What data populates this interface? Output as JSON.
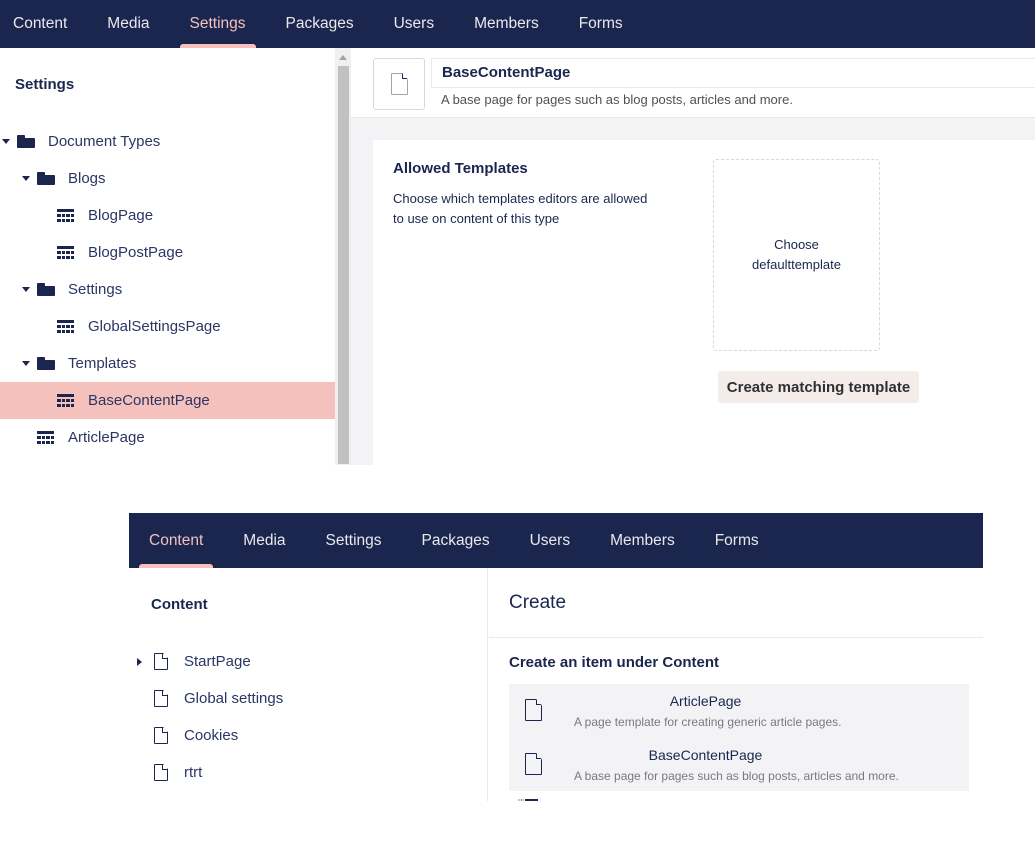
{
  "top": {
    "nav": {
      "items": [
        "Content",
        "Media",
        "Settings",
        "Packages",
        "Users",
        "Members",
        "Forms"
      ],
      "active": "Settings"
    },
    "sidebar": {
      "title": "Settings",
      "tree": [
        {
          "label": "Document Types",
          "type": "folder",
          "expanded": true,
          "level": 0
        },
        {
          "label": "Blogs",
          "type": "folder",
          "expanded": true,
          "level": 1
        },
        {
          "label": "BlogPage",
          "type": "document-type",
          "level": 2
        },
        {
          "label": "BlogPostPage",
          "type": "document-type",
          "level": 2
        },
        {
          "label": "Settings",
          "type": "folder",
          "expanded": true,
          "level": 1
        },
        {
          "label": "GlobalSettingsPage",
          "type": "document-type",
          "level": 2
        },
        {
          "label": "Templates",
          "type": "folder",
          "expanded": true,
          "level": 1
        },
        {
          "label": "BaseContentPage",
          "type": "document-type",
          "level": 2,
          "selected": true
        },
        {
          "label": "ArticlePage",
          "type": "document-type",
          "level": 1
        }
      ]
    },
    "editor": {
      "name": "BaseContentPage",
      "description": "A base page for pages such as blog posts, articles and more.",
      "allowed_templates": {
        "title": "Allowed Templates",
        "description": "Choose which templates editors are allowed to use on content of this type",
        "choose_label": "Choose defaulttemplate",
        "create_button": "Create matching template"
      }
    }
  },
  "bottom": {
    "nav": {
      "items": [
        "Content",
        "Media",
        "Settings",
        "Packages",
        "Users",
        "Members",
        "Forms"
      ],
      "active": "Content"
    },
    "sidebar": {
      "title": "Content",
      "tree": [
        {
          "label": "StartPage",
          "has_children": true
        },
        {
          "label": "Global settings",
          "has_children": false
        },
        {
          "label": "Cookies",
          "has_children": false
        },
        {
          "label": "rtrt",
          "has_children": false
        }
      ]
    },
    "create": {
      "title": "Create",
      "subtitle": "Create an item under Content",
      "items": [
        {
          "name": "ArticlePage",
          "description": "A page template for creating generic article pages."
        },
        {
          "name": "BaseContentPage",
          "description": "A base page for pages such as blog posts, articles and more."
        }
      ]
    }
  },
  "colors": {
    "nav_bg": "#1b264f",
    "accent": "#f5c1bc",
    "selected_bg": "#f5c1bc",
    "editor_bg": "#f3f3f5",
    "button_bg": "#f3ece9"
  }
}
